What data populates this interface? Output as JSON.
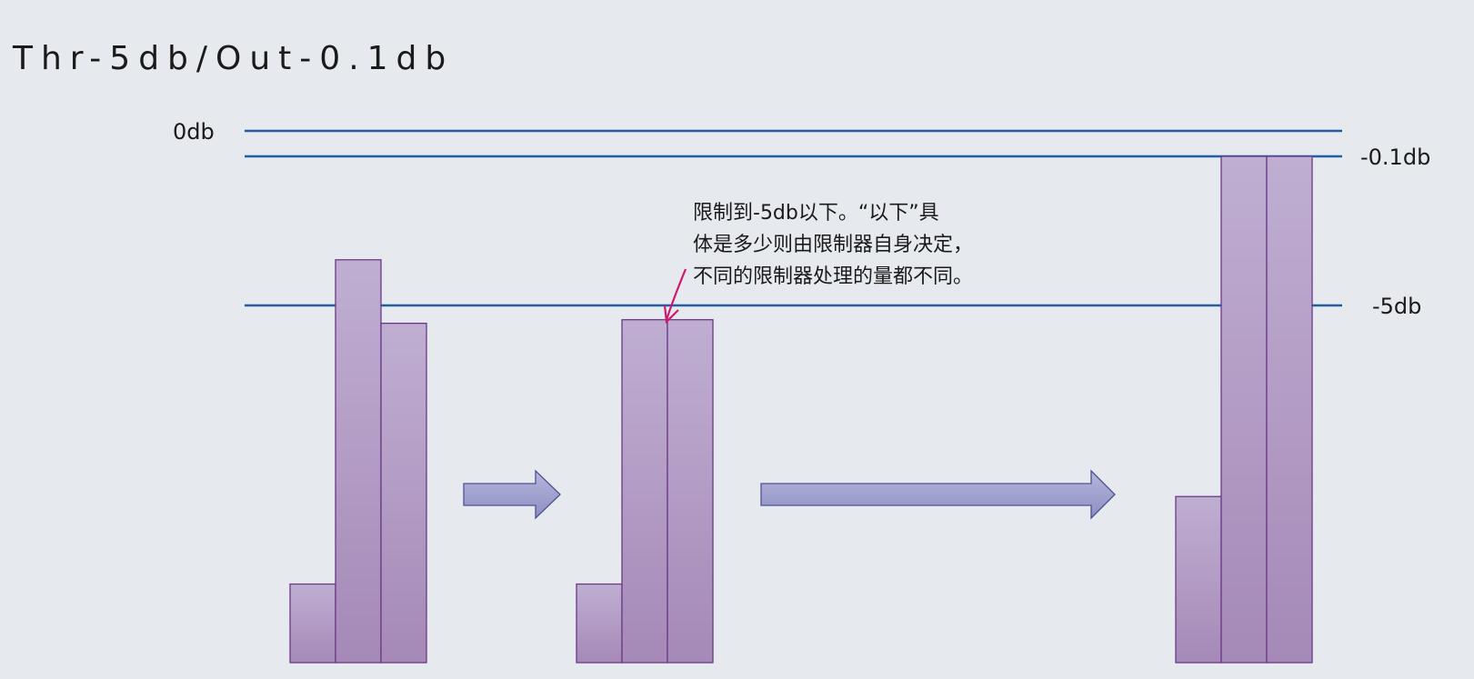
{
  "title": "Thr-5db/Out-0.1db",
  "levels": {
    "zero": "0db",
    "out": "-0.1db",
    "threshold": "-5db"
  },
  "annotation": {
    "lines": [
      "限制到-5db以下。“以下”具",
      "体是多少则由限制器自身决定，",
      "不同的限制器处理的量都不同。"
    ]
  },
  "stages": [
    {
      "name": "input",
      "bars_db": [
        -20.6,
        -3.5,
        -6.0
      ]
    },
    {
      "name": "limited",
      "bars_db": [
        -20.6,
        -5.8,
        -5.8
      ]
    },
    {
      "name": "output",
      "bars_db": [
        -15.7,
        -0.1,
        -0.1
      ]
    }
  ],
  "arrows": [
    {
      "from": "input",
      "to": "limited"
    },
    {
      "from": "limited",
      "to": "output"
    }
  ],
  "colors": {
    "level_line": "#1f5fa6",
    "bar_fill_top": "#c0aed2",
    "bar_fill_bottom": "#a589b7",
    "bar_stroke": "#6a3a86",
    "arrow_fill_top": "#b6b7dc",
    "arrow_fill_bottom": "#8c8fc2",
    "arrow_stroke": "#4e5294",
    "pointer": "#d0176f"
  }
}
